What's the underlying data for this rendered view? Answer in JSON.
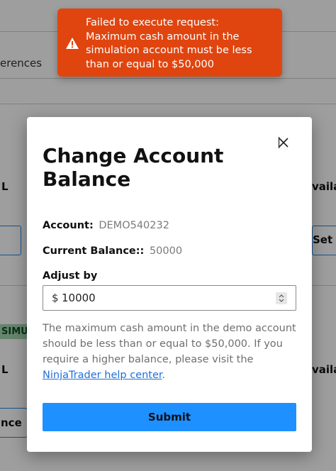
{
  "background": {
    "tab_fragment": "erences",
    "left_fragment_1": "L",
    "left_fragment_2": "L",
    "badge_fragment": "SIMU",
    "button_fragment_bottom": "nce",
    "right_fragment_1": "vaila",
    "right_fragment_2": "vaila",
    "right_button_fragment": "Set N"
  },
  "toast": {
    "icon": "warning-icon",
    "message": "Failed to execute request:\nMaximum cash amount in the simulation account must be less than or equal to $50,000",
    "color": "#e0450f"
  },
  "modal": {
    "title": "Change Account Balance",
    "close_icon": "close-icon",
    "account_label": "Account:",
    "account_value": "DEMO540232",
    "balance_label": "Current Balance::",
    "balance_value": "50000",
    "adjust_label": "Adjust by",
    "currency_symbol": "$",
    "adjust_value": "10000",
    "help_text_before": "The maximum cash amount in the demo account should be less than or equal to $50,000. If you require a higher balance, please visit the ",
    "help_link": "NinjaTrader help center",
    "help_text_after": ".",
    "submit_label": "Submit",
    "accent_color": "#1e90ff"
  }
}
